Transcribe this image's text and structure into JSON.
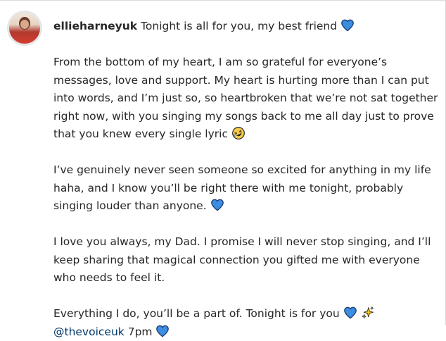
{
  "post": {
    "username": "ellieharneyuk",
    "first_line": "Tonight is all for you, my best friend",
    "paragraphs": [
      "From the bottom of my heart, I am so grateful for everyone’s messages, love and support. My heart is hurting more than I can put into words, and I’m just so, so heartbroken that we’re not sat together right now, with you singing my songs back to me all day just to prove that you knew every single lyric",
      "I’ve genuinely never seen someone so excited for anything in my life haha, and I know you’ll be right there with me tonight, probably singing louder than anyone.",
      "I love you always, my Dad. I promise I will never stop singing, and I’ll keep sharing that magical connection you gifted me with everyone who needs to feel it."
    ],
    "closing_line": "Everything I do, you’ll be a part of. Tonight is for you",
    "mention": "@thevoiceuk",
    "time": "7pm"
  },
  "icons": {
    "heart": "blue-heart-icon",
    "laugh": "rolling-laughing-emoji-icon",
    "sparkles": "sparkles-icon"
  },
  "colors": {
    "text": "#262626",
    "mention": "#00376b",
    "heart": "#3d8de0",
    "heart_outline": "#1a3a6e"
  }
}
